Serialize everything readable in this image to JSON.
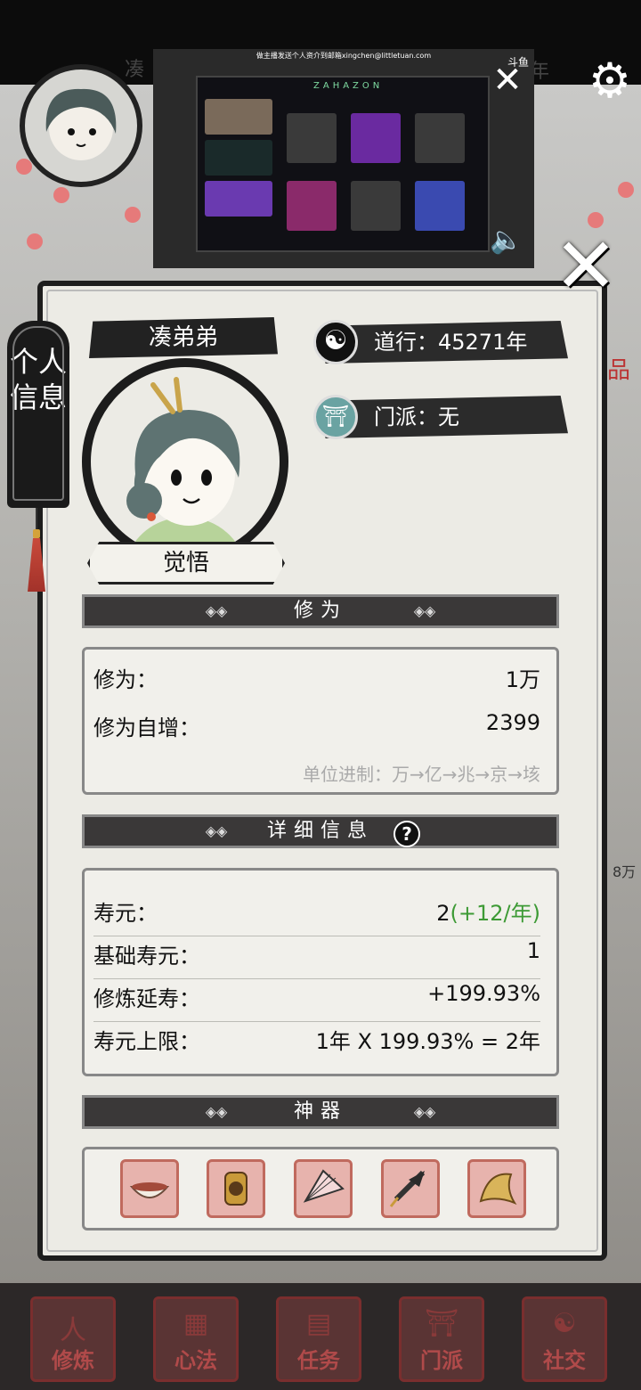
{
  "background": {
    "title_left": "凑",
    "title_right": "年",
    "right_fragment": "8万",
    "red_mark": "品"
  },
  "video_overlay": {
    "top_text": "做主播发送个人资介到邮箱xingchen@littletuan.com",
    "screen_title": "ZAHAZON",
    "brand": "斗鱼",
    "close_icon": "close-icon",
    "sound_icon": "speaker-icon"
  },
  "side_tab": {
    "label": "个人信息"
  },
  "profile": {
    "name": "凑弟弟",
    "title_badge": "觉悟",
    "daoxing": "道行：45271年",
    "sect": "门派：无"
  },
  "section_xiuwei": {
    "header": "修为",
    "rows": [
      {
        "label": "修为：",
        "value": "1万"
      },
      {
        "label": "修为自增：",
        "value": "2399"
      }
    ],
    "unit_note": "单位进制：万→亿→兆→京→垓"
  },
  "section_detail": {
    "header": "详细信息",
    "help": "?",
    "rows": [
      {
        "label": "寿元：",
        "value": "2",
        "value_extra": "(+12/年)"
      },
      {
        "label": "基础寿元：",
        "value": "1"
      },
      {
        "label": "修炼延寿：",
        "value": "+199.93%"
      },
      {
        "label": "寿元上限：",
        "value": "1年 X 199.93% = 2年"
      }
    ]
  },
  "section_artifact": {
    "header": "神器",
    "items": [
      {
        "icon": "bowl-icon"
      },
      {
        "icon": "token-icon"
      },
      {
        "icon": "fan-icon"
      },
      {
        "icon": "umbrella-icon"
      },
      {
        "icon": "claw-icon"
      }
    ]
  },
  "bottom_nav": [
    {
      "label": "修炼"
    },
    {
      "label": "心法"
    },
    {
      "label": "任务"
    },
    {
      "label": "门派"
    },
    {
      "label": "社交"
    }
  ],
  "colors": {
    "accent_green": "#3d9a35",
    "panel_bg": "#ecebe5",
    "ink": "#1d1d1d"
  }
}
